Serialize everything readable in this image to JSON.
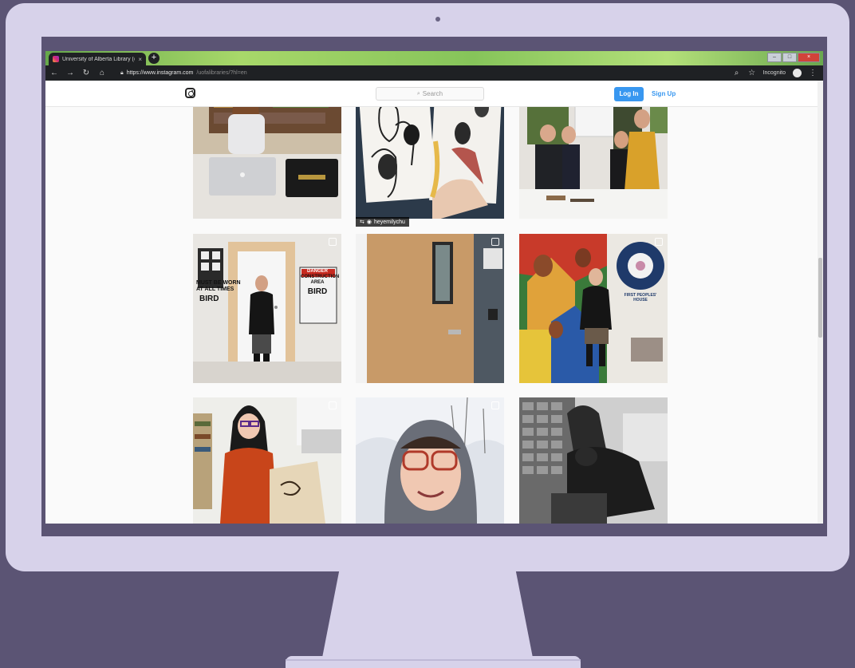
{
  "browser": {
    "tab_title": "University of Alberta Library (@u",
    "tab_close": "×",
    "new_tab": "+",
    "window_controls": [
      "–",
      "□",
      "×"
    ],
    "url_host": "https://www.instagram.com",
    "url_path": "/uofalibraries/?hl=en",
    "incognito_label": "Incognito",
    "nav_icons": [
      "back-arrow-icon",
      "forward-arrow-icon",
      "reload-icon",
      "home-icon"
    ],
    "nav_glyphs": [
      "←",
      "→",
      "↻",
      "⌂"
    ]
  },
  "instagram": {
    "search_placeholder": "Search",
    "login_label": "Log In",
    "signup_label": "Sign Up",
    "accent_color": "#3897f0"
  },
  "grid": {
    "posts": [
      {
        "id": "student-laptop",
        "scene": "library-desk"
      },
      {
        "id": "sketchbook",
        "scene": "sketchbook",
        "credit": "heyemilychu"
      },
      {
        "id": "library-staff",
        "scene": "poster-booth"
      },
      {
        "id": "construction-door",
        "scene": "construction-door",
        "signs": [
          "DANGER",
          "CONSTRUCTION",
          "AREA",
          "BIRD",
          "MUST BE WORN",
          "AT ALL TIMES"
        ]
      },
      {
        "id": "wooden-door",
        "scene": "wooden-door"
      },
      {
        "id": "mural",
        "scene": "mural",
        "sign": "FIRST PEOPLES' HOUSE"
      },
      {
        "id": "artist-portrait",
        "scene": "artist"
      },
      {
        "id": "winter-selfie",
        "scene": "winter"
      },
      {
        "id": "card-catalogue",
        "scene": "card-catalogue"
      }
    ]
  }
}
